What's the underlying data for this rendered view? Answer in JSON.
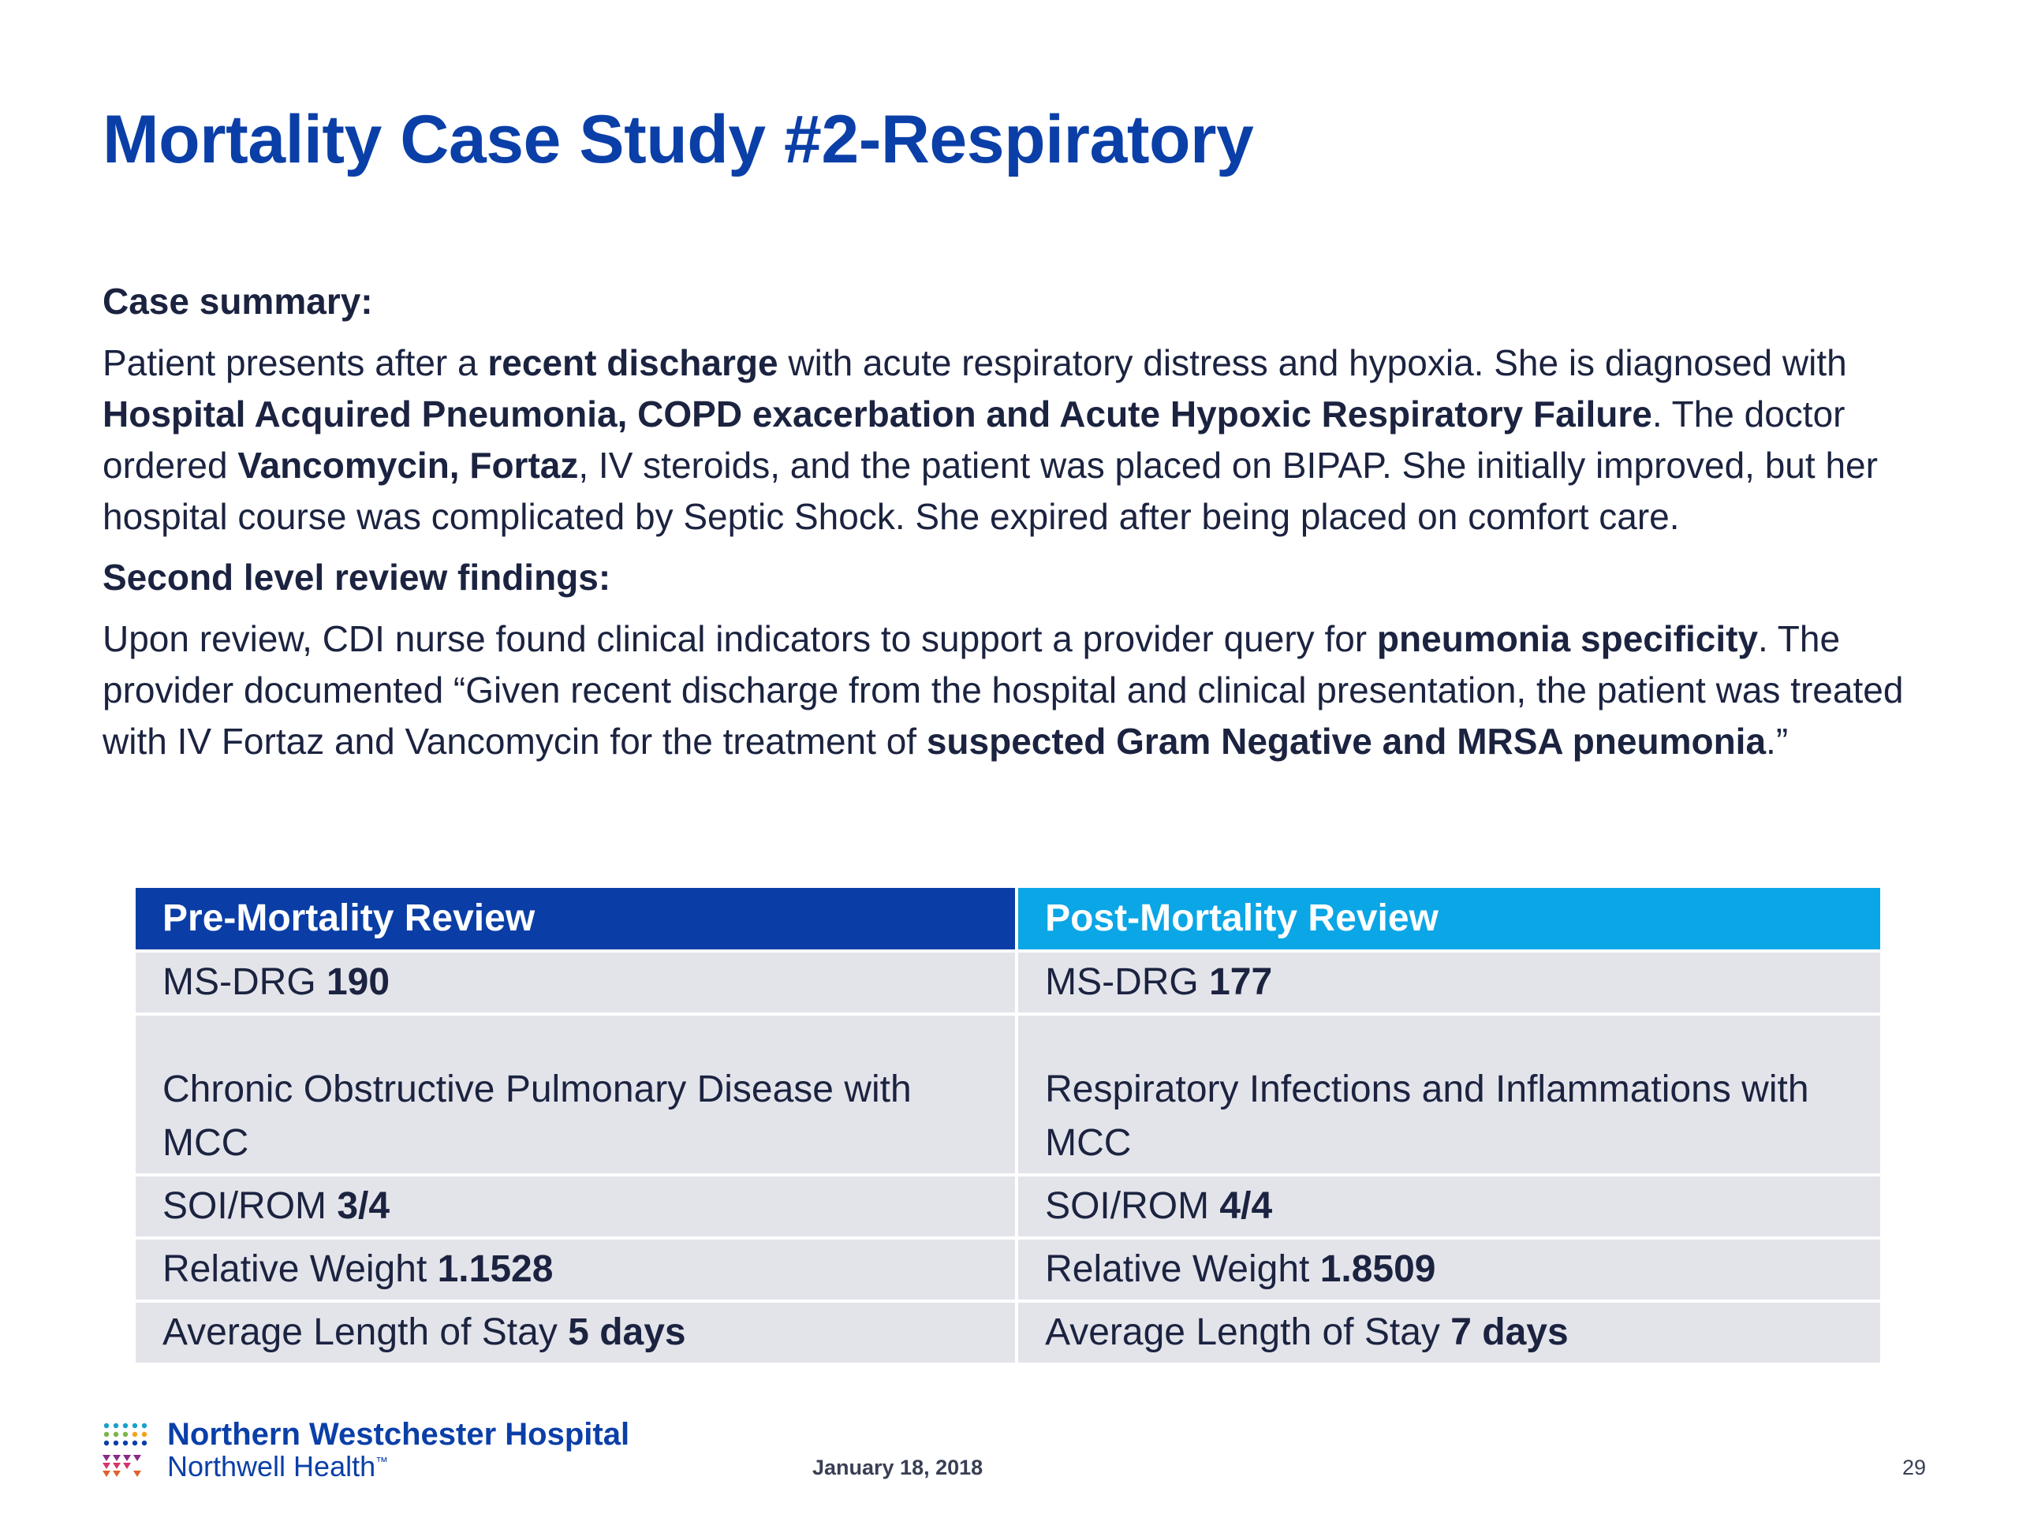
{
  "slide": {
    "title": "Mortality Case Study #2-Respiratory",
    "case_summary": {
      "heading": "Case summary:",
      "p1": "Patient presents after a ",
      "b1": "recent discharge",
      "p2": " with acute respiratory distress and hypoxia. She is diagnosed with ",
      "b2": "Hospital Acquired Pneumonia, COPD exacerbation and Acute Hypoxic Respiratory Failure",
      "p3": ". The doctor ordered ",
      "b3": "Vancomycin, Fortaz",
      "p4": ", IV steroids, and the patient was placed on BIPAP. She initially improved, but her hospital course was complicated by Septic Shock. She expired after being placed on comfort care."
    },
    "review_findings": {
      "heading": "Second level review findings:",
      "p1": "Upon review, CDI nurse found clinical indicators to support a provider query for ",
      "b1": "pneumonia specificity",
      "p2": ". The provider documented “Given recent discharge from the hospital and clinical presentation, the patient was treated with IV Fortaz and Vancomycin for the treatment of ",
      "b2": "suspected Gram Negative and MRSA pneumonia",
      "p3": ".”"
    },
    "table": {
      "pre_header": "Pre-Mortality Review",
      "post_header": "Post-Mortality Review",
      "rows": [
        {
          "pre_label": "MS-DRG ",
          "pre_value": "190",
          "post_label": "MS-DRG ",
          "post_value": "177"
        },
        {
          "pre_label": "Chronic Obstructive Pulmonary Disease with MCC",
          "pre_value": "",
          "post_label": "Respiratory Infections and Inflammations with MCC",
          "post_value": ""
        },
        {
          "pre_label": "SOI/ROM ",
          "pre_value": "3/4",
          "post_label": "SOI/ROM ",
          "post_value": "4/4"
        },
        {
          "pre_label": "Relative Weight ",
          "pre_value": "1.1528",
          "post_label": "Relative Weight ",
          "post_value": "1.8509"
        },
        {
          "pre_label": "Average Length of Stay ",
          "pre_value": "5 days",
          "post_label": "Average Length of Stay ",
          "post_value": "7 days"
        }
      ]
    },
    "footer": {
      "logo_line1": "Northern Westchester Hospital",
      "logo_line2": "Northwell Health",
      "logo_tm": "™",
      "date": "January 18, 2018",
      "page_number": "29"
    },
    "colors": {
      "title": "#0b3fa8",
      "pre_header_bg": "#0a3ea6",
      "post_header_bg": "#0aa6e6",
      "cell_bg": "#e3e4ea"
    }
  }
}
